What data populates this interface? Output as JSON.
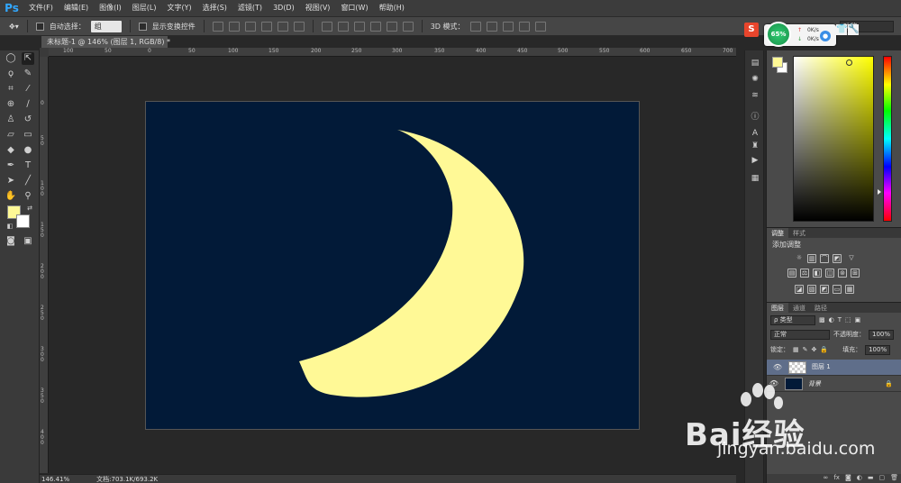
{
  "app": {
    "logo": "Ps"
  },
  "menu": [
    "文件(F)",
    "编辑(E)",
    "图像(I)",
    "图层(L)",
    "文字(Y)",
    "选择(S)",
    "滤镜(T)",
    "3D(D)",
    "视图(V)",
    "窗口(W)",
    "帮助(H)"
  ],
  "options": {
    "auto_select_label": "自动选择：",
    "auto_select_value": "组",
    "show_transform_label": "显示变换控件",
    "mode_3d_label": "3D 模式：",
    "workspace": "功能"
  },
  "document": {
    "tab_title": "未标题-1 @ 146% (图层 1, RGB/8) *",
    "background_color": "#021a38",
    "moon_color": "#fff996"
  },
  "rulers": {
    "horizontal": [
      "100",
      "50",
      "0",
      "50",
      "100",
      "150",
      "200",
      "250",
      "300",
      "350",
      "400",
      "450",
      "500",
      "550",
      "600",
      "650",
      "700"
    ],
    "vertical": [
      "0",
      "5 0",
      "1 0 0",
      "1 5 0",
      "2 0 0",
      "2 5 0",
      "3 0 0",
      "3 5 0",
      "4 0 0"
    ]
  },
  "status": {
    "zoom": "146.41%",
    "doc_size": "文档:703.1K/693.2K"
  },
  "colors": {
    "foreground": "#fff996",
    "background": "#ffffff"
  },
  "network_widget": {
    "percent": "65%",
    "up": "0K/s",
    "down": "0K/s"
  },
  "panels": {
    "adjust_tabs": [
      "调整",
      "样式"
    ],
    "adjust_title": "添加调整",
    "layer_tabs": [
      "图层",
      "通道",
      "路径"
    ],
    "kind_filter": "ρ 类型",
    "blend_mode": "正常",
    "opacity_label": "不透明度：",
    "opacity_value": "100%",
    "lock_label": "锁定：",
    "fill_label": "填充：",
    "fill_value": "100%",
    "layers": [
      {
        "name": "图层 1",
        "selected": true
      },
      {
        "name": "背景",
        "selected": false
      }
    ]
  },
  "watermark": {
    "text": "Bai经验",
    "url": "jingyan.baidu.com"
  }
}
